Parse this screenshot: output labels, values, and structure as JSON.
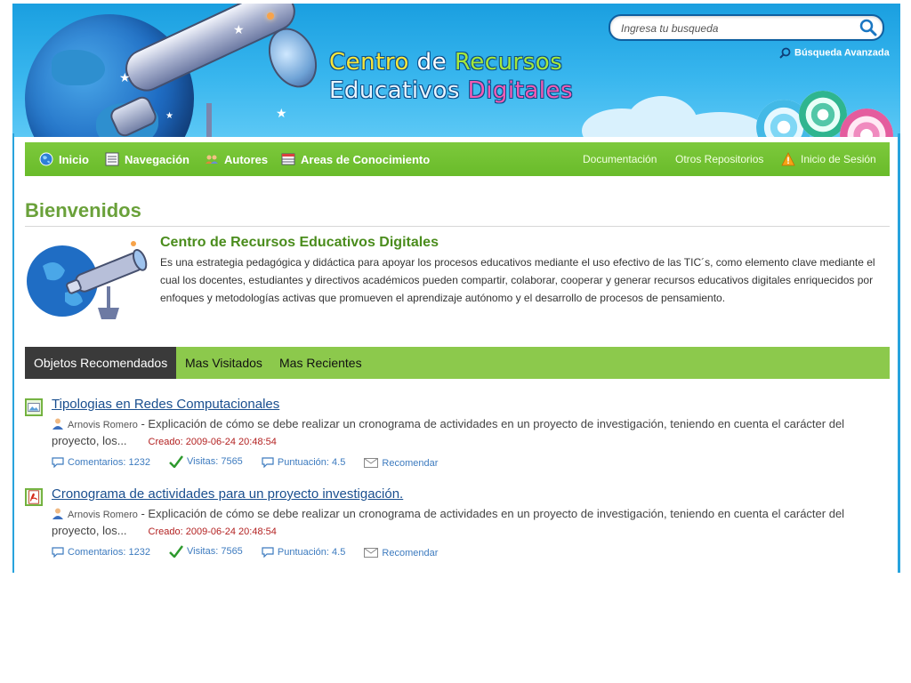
{
  "header": {
    "title_words": [
      "Centro",
      "de",
      "Recursos",
      "Educativos",
      "Digitales"
    ],
    "search_placeholder": "Ingresa tu busqueda",
    "advanced_search": "Búsqueda Avanzada"
  },
  "nav": {
    "left": [
      {
        "label": "Inicio",
        "icon": "globe-icon"
      },
      {
        "label": "Navegación",
        "icon": "list-icon"
      },
      {
        "label": "Autores",
        "icon": "users-icon"
      },
      {
        "label": "Areas de Conocimiento",
        "icon": "table-icon"
      }
    ],
    "right": [
      {
        "label": "Documentación"
      },
      {
        "label": "Otros Repositorios"
      },
      {
        "label": "Inicio de Sesión",
        "icon": "warning-icon"
      }
    ]
  },
  "welcome": {
    "heading": "Bienvenidos",
    "intro_title": "Centro de Recursos Educativos Digitales",
    "intro_text": "Es una estrategia pedagógica y didáctica para apoyar los procesos educativos mediante el uso efectivo de las TIC´s, como elemento clave mediante el cual los docentes, estudiantes y directivos académicos pueden compartir, colaborar, cooperar  y generar recursos educativos digitales enriquecidos por enfoques y metodologías activas que promueven el aprendizaje autónomo y el desarrollo de procesos de pensamiento."
  },
  "tabs": [
    "Objetos Recomendados",
    "Mas Visitados",
    "Mas Recientes"
  ],
  "items": [
    {
      "title": "Tipologias en Redes Computacionales",
      "icon": "image-file-icon",
      "author": "Arnovis Romero",
      "description": " - Explicación de cómo se debe realizar un cronograma de actividades en un proyecto de investigación, teniendo en cuenta el carácter del proyecto, los...",
      "created": "Creado: 2009-06-24 20:48:54",
      "comments": "Comentarios: 1232",
      "visits": "Visitas: 7565",
      "rating": "Puntuación: 4.5",
      "recommend": "Recomendar"
    },
    {
      "title": "Cronograma de actividades para un proyecto investigación.",
      "icon": "pdf-file-icon",
      "author": "Arnovis Romero",
      "description": " - Explicación de cómo se debe realizar un cronograma de actividades en un proyecto de investigación, teniendo en cuenta el carácter del proyecto, los...",
      "created": "Creado: 2009-06-24 20:48:54",
      "comments": "Comentarios: 1232",
      "visits": "Visitas: 7565",
      "rating": "Puntuación: 4.5",
      "recommend": "Recomendar"
    }
  ],
  "colors": {
    "nav_green": "#6fbe2f",
    "tab_green": "#8cc94c",
    "tab_active": "#3a3a3a",
    "heading_green": "#6aa13a",
    "link_blue": "#1a4f8f",
    "header_blue": "#28a3dd"
  }
}
